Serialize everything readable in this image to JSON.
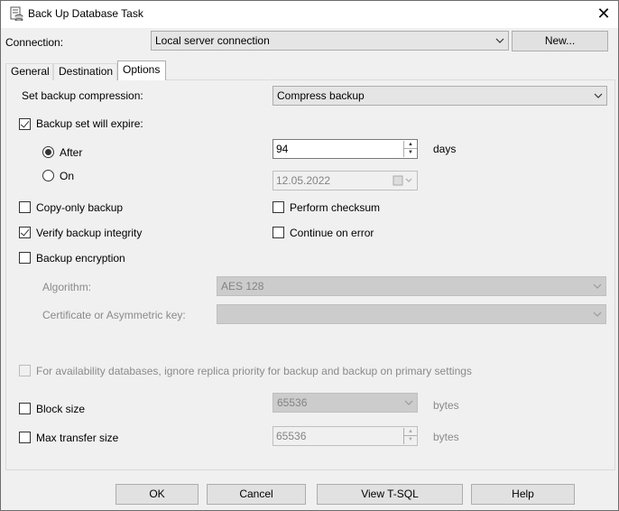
{
  "window": {
    "title": "Back Up Database Task",
    "close_label": "✕"
  },
  "connection": {
    "label": "Connection:",
    "value": "Local server connection",
    "new_button": "New..."
  },
  "tabs": [
    {
      "label": "General"
    },
    {
      "label": "Destination"
    },
    {
      "label": "Options"
    }
  ],
  "options": {
    "compression_label": "Set backup compression:",
    "compression_value": "Compress backup",
    "expire_label": "Backup set will expire:",
    "after_label": "After",
    "after_value": "94",
    "days_label": "days",
    "on_label": "On",
    "on_date": "12.05.2022",
    "copy_only_label": "Copy-only backup",
    "checksum_label": "Perform checksum",
    "verify_label": "Verify backup integrity",
    "continue_label": "Continue on error",
    "encryption_label": "Backup encryption",
    "algorithm_label": "Algorithm:",
    "algorithm_value": "AES 128",
    "cert_label": "Certificate or Asymmetric key:",
    "cert_value": "",
    "availability_label": "For availability databases, ignore replica priority for backup and backup on primary settings",
    "block_size_label": "Block size",
    "block_size_value": "65536",
    "block_size_unit": "bytes",
    "max_transfer_label": "Max transfer size",
    "max_transfer_value": "65536",
    "max_transfer_unit": "bytes"
  },
  "state": {
    "expire_checked": true,
    "after_selected": true,
    "copy_only_checked": false,
    "checksum_checked": false,
    "verify_checked": true,
    "continue_checked": false,
    "encryption_checked": false,
    "availability_checked": false,
    "block_size_checked": false,
    "max_transfer_checked": false
  },
  "buttons": {
    "ok": "OK",
    "cancel": "Cancel",
    "view_tsql": "View T-SQL",
    "help": "Help"
  }
}
